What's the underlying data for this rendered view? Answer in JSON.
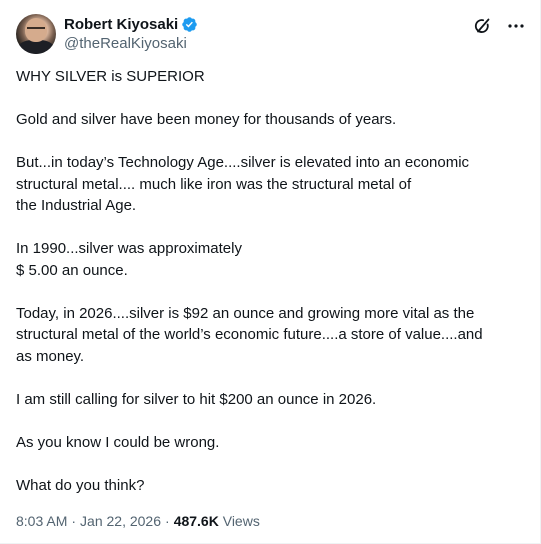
{
  "author": {
    "display_name": "Robert Kiyosaki",
    "handle": "@theRealKiyosaki",
    "verified_color": "#1d9bf0"
  },
  "icons": {
    "grok": "grok-icon",
    "more": "more-icon",
    "verified": "verified-badge-icon"
  },
  "tweet": {
    "paragraphs": [
      "WHY SILVER is SUPERIOR",
      "Gold and silver have been money for thousands of years.",
      "But...in today’s Technology Age....silver is elevated into an economic\nstructural metal.... much like iron was the structural metal of\nthe Industrial Age.",
      "In 1990...silver was approximately\n$ 5.00 an ounce.",
      "Today, in 2026....silver is $92 an ounce and growing more vital as the\nstructural metal of the world’s economic future....a store of value....and\nas money.",
      "I am still calling for silver to hit $200 an ounce in 2026.",
      "As you know I could be wrong.",
      "What do you think?"
    ],
    "time": "8:03 AM",
    "separator": "·",
    "date": "Jan 22, 2026",
    "views_count": "487.6K",
    "views_label": "Views"
  }
}
